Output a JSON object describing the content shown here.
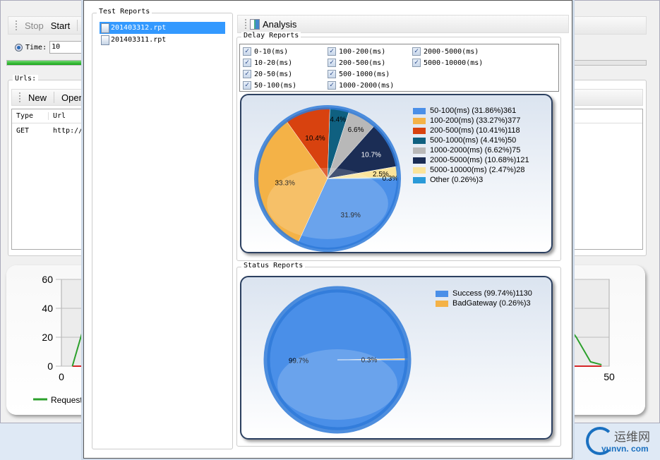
{
  "bg_app": {
    "toolbar": {
      "stop": "Stop",
      "start": "Start",
      "analysis_partial": "An"
    },
    "time_label": "Time:",
    "time_value": "10",
    "progress": 0.25,
    "urls_title": "Urls:",
    "urls_toolbar": {
      "new": "New",
      "open": "Open"
    },
    "table": {
      "headers": [
        "Type",
        "Url"
      ],
      "rows": [
        [
          "GET",
          "http://"
        ]
      ]
    },
    "chart": {
      "y_ticks": [
        "60",
        "40",
        "20",
        "0"
      ],
      "x_ticks": [
        "0",
        "50"
      ],
      "legend": "Requests",
      "xlim": [
        0,
        50
      ],
      "ylim": [
        0,
        60
      ],
      "requests": [
        [
          1,
          0
        ],
        [
          2,
          26
        ],
        [
          46,
          30
        ],
        [
          47,
          20
        ],
        [
          48.3,
          3
        ],
        [
          49.3,
          1
        ]
      ],
      "errors": [
        [
          1,
          0
        ],
        [
          49.3,
          0
        ]
      ],
      "colors": {
        "requests": "#2ca02c",
        "errors": "#d62728"
      }
    }
  },
  "dialog": {
    "test_reports_title": "Test Reports",
    "files": [
      {
        "name": "201403312.rpt",
        "selected": true
      },
      {
        "name": "201403311.rpt",
        "selected": false
      }
    ],
    "analysis_button": "Analysis",
    "delay_reports_title": "Delay  Reports",
    "delay_filters": [
      {
        "label": "0-10(ms)",
        "checked": true
      },
      {
        "label": "10-20(ms)",
        "checked": true
      },
      {
        "label": "20-50(ms)",
        "checked": true
      },
      {
        "label": "50-100(ms)",
        "checked": true
      },
      {
        "label": "100-200(ms)",
        "checked": true
      },
      {
        "label": "200-500(ms)",
        "checked": true
      },
      {
        "label": "500-1000(ms)",
        "checked": true
      },
      {
        "label": "1000-2000(ms)",
        "checked": true
      },
      {
        "label": "2000-5000(ms)",
        "checked": true
      },
      {
        "label": "5000-10000(ms)",
        "checked": true
      }
    ],
    "status_reports_title": "Status Reports"
  },
  "chart_data": [
    {
      "type": "pie",
      "title": "Delay Reports",
      "slices": [
        {
          "name": "50-100(ms)",
          "percent": 31.86,
          "count": 361,
          "legend": "50-100(ms) (31.86%)361",
          "label": "31.9%",
          "color": "#4a8fe8"
        },
        {
          "name": "100-200(ms)",
          "percent": 33.27,
          "count": 377,
          "legend": "100-200(ms) (33.27%)377",
          "label": "33.3%",
          "color": "#f4b247"
        },
        {
          "name": "200-500(ms)",
          "percent": 10.41,
          "count": 118,
          "legend": "200-500(ms) (10.41%)118",
          "label": "10.4%",
          "color": "#d8420f"
        },
        {
          "name": "500-1000(ms)",
          "percent": 4.41,
          "count": 50,
          "legend": "500-1000(ms) (4.41%)50",
          "label": "4.4%",
          "color": "#0f6080"
        },
        {
          "name": "1000-2000(ms)",
          "percent": 6.62,
          "count": 75,
          "legend": "1000-2000(ms) (6.62%)75",
          "label": "6.6%",
          "color": "#b8b8b8"
        },
        {
          "name": "2000-5000(ms)",
          "percent": 10.68,
          "count": 121,
          "legend": "2000-5000(ms) (10.68%)121",
          "label": "10.7%",
          "color": "#1b2d55"
        },
        {
          "name": "5000-10000(ms)",
          "percent": 2.47,
          "count": 28,
          "legend": "5000-10000(ms) (2.47%)28",
          "label": "2.5%",
          "color": "#fbe49a"
        },
        {
          "name": "Other",
          "percent": 0.26,
          "count": 3,
          "legend": "Other (0.26%)3",
          "label": "0.3%",
          "color": "#2a9ad8"
        }
      ]
    },
    {
      "type": "pie",
      "title": "Status Reports",
      "slices": [
        {
          "name": "Success",
          "percent": 99.74,
          "count": 1130,
          "legend": "Success (99.74%)1130",
          "label": "99.7%",
          "color": "#4a8fe8"
        },
        {
          "name": "BadGateway",
          "percent": 0.26,
          "count": 3,
          "legend": "BadGateway (0.26%)3",
          "label": "0.3%",
          "color": "#f4b247"
        }
      ]
    }
  ],
  "watermark": {
    "text": "运维网",
    "url": "yunvn. com"
  }
}
